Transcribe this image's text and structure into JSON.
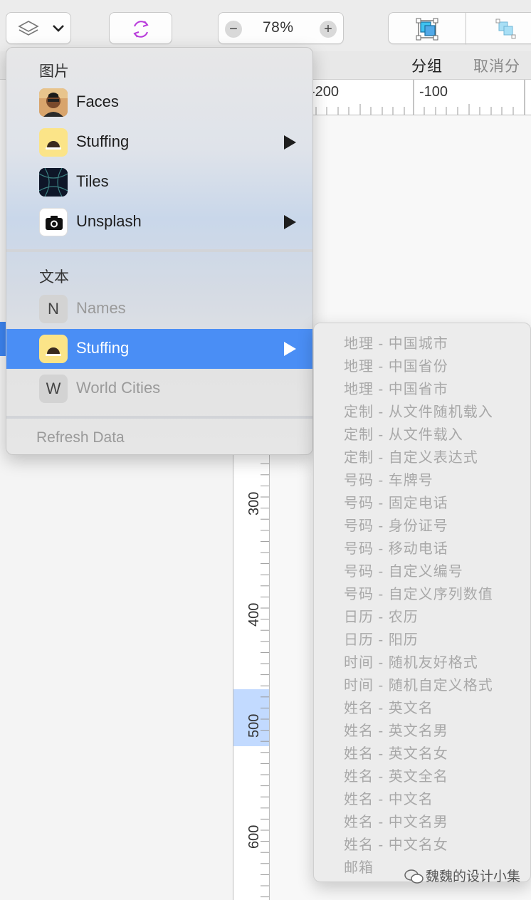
{
  "toolbar": {
    "layers_icon": "layers-icon",
    "dropdown_icon": "chevron-down-icon",
    "refresh_icon": "refresh-icon",
    "zoom": "78%",
    "zoom_minus": "−",
    "zoom_plus": "+",
    "group_label": "分组",
    "ungroup_label": "取消分组"
  },
  "ruler": {
    "h_ticks": [
      "-200",
      "-100"
    ],
    "v_ticks": [
      "300",
      "400",
      "500",
      "600"
    ]
  },
  "menu": {
    "image_header": "图片",
    "image_items": [
      {
        "label": "Faces",
        "icon": "faces-icon",
        "submenu": false
      },
      {
        "label": "Stuffing",
        "icon": "stuffing-icon",
        "submenu": true
      },
      {
        "label": "Tiles",
        "icon": "tiles-icon",
        "submenu": false
      },
      {
        "label": "Unsplash",
        "icon": "camera-icon",
        "submenu": true
      }
    ],
    "text_header": "文本",
    "text_items": [
      {
        "label": "Names",
        "icon_letter": "N",
        "disabled": true
      },
      {
        "label": "Stuffing",
        "icon": "stuffing-icon",
        "submenu": true,
        "selected": true
      },
      {
        "label": "World Cities",
        "icon_letter": "W",
        "disabled": true
      }
    ],
    "refresh": "Refresh Data"
  },
  "submenu": {
    "items": [
      "地理 - 中国城市",
      "地理 - 中国省份",
      "地理 - 中国省市",
      "定制 - 从文件随机载入",
      "定制 - 从文件载入",
      "定制 - 自定义表达式",
      "号码 - 车牌号",
      "号码 - 固定电话",
      "号码 - 身份证号",
      "号码 - 移动电话",
      "号码 - 自定义编号",
      "号码 - 自定义序列数值",
      "日历 - 农历",
      "日历 - 阳历",
      "时间 - 随机友好格式",
      "时间 - 随机自定义格式",
      "姓名 - 英文名",
      "姓名 - 英文名男",
      "姓名 - 英文名女",
      "姓名 - 英文全名",
      "姓名 - 中文名",
      "姓名 - 中文名男",
      "姓名 - 中文名女",
      "邮箱"
    ]
  },
  "watermark": "魏魏的设计小集",
  "colors": {
    "selection": "#4a8ef5",
    "refresh_icon": "#b93ddb",
    "accent_cyan": "#3fc2f0"
  }
}
